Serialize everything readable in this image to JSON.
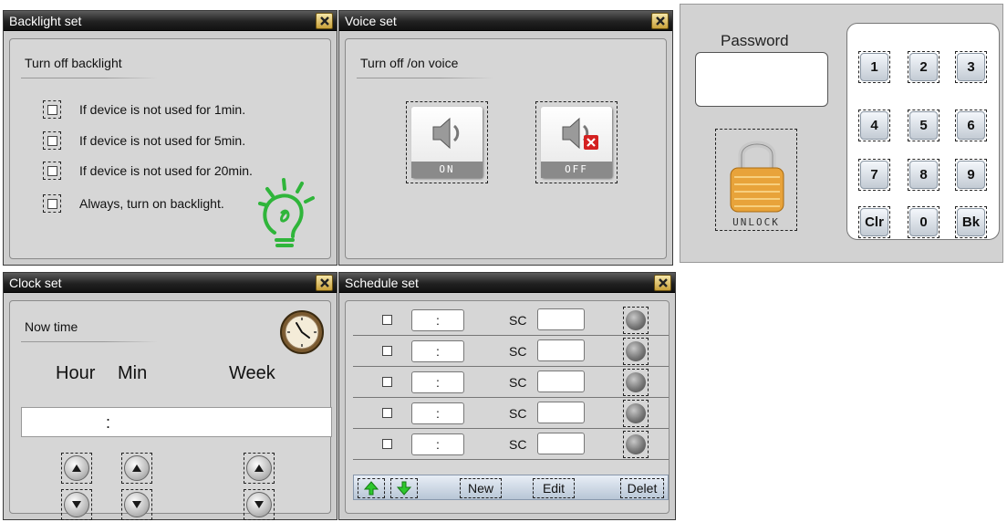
{
  "backlight": {
    "title": "Backlight set",
    "section": "Turn off backlight",
    "options": [
      "If device is not used for 1min.",
      "If device is not used for 5min.",
      "If device is not used for 20min.",
      "Always, turn on backlight."
    ]
  },
  "voice": {
    "title": "Voice set",
    "section": "Turn off /on voice",
    "on_label": "ON",
    "off_label": "OFF"
  },
  "password": {
    "label": "Password",
    "value": "",
    "keys": [
      "1",
      "2",
      "3",
      "4",
      "5",
      "6",
      "7",
      "8",
      "9",
      "Clr",
      "0",
      "Bk"
    ],
    "unlock_label": "UNLOCK"
  },
  "clock": {
    "title": "Clock set",
    "section": "Now time",
    "hour_label": "Hour",
    "min_label": "Min",
    "week_label": "Week",
    "time_sep": ":"
  },
  "schedule": {
    "title": "Schedule set",
    "rows": [
      {
        "time": ":",
        "sc_label": "SC",
        "sc_value": ""
      },
      {
        "time": ":",
        "sc_label": "SC",
        "sc_value": ""
      },
      {
        "time": ":",
        "sc_label": "SC",
        "sc_value": ""
      },
      {
        "time": ":",
        "sc_label": "SC",
        "sc_value": ""
      },
      {
        "time": ":",
        "sc_label": "SC",
        "sc_value": ""
      }
    ],
    "new_label": "New",
    "edit_label": "Edit",
    "delete_label": "Delet"
  },
  "icons": {
    "close": "close-icon",
    "bulb": "lightbulb-icon",
    "speaker": "speaker-icon",
    "mute": "mute-x-icon",
    "padlock": "padlock-icon",
    "clock": "clock-icon",
    "up": "arrow-up-icon",
    "down": "arrow-down-icon",
    "led": "led-indicator-icon"
  },
  "colors": {
    "titlebar": "#1a1a1a",
    "panel_bg": "#cdcdcd",
    "close_btn": "#d9b957",
    "bulb_green": "#2fb53a",
    "mute_red": "#d42020",
    "lock_gold": "#e8a33a",
    "arrow_green": "#2ec82e"
  }
}
